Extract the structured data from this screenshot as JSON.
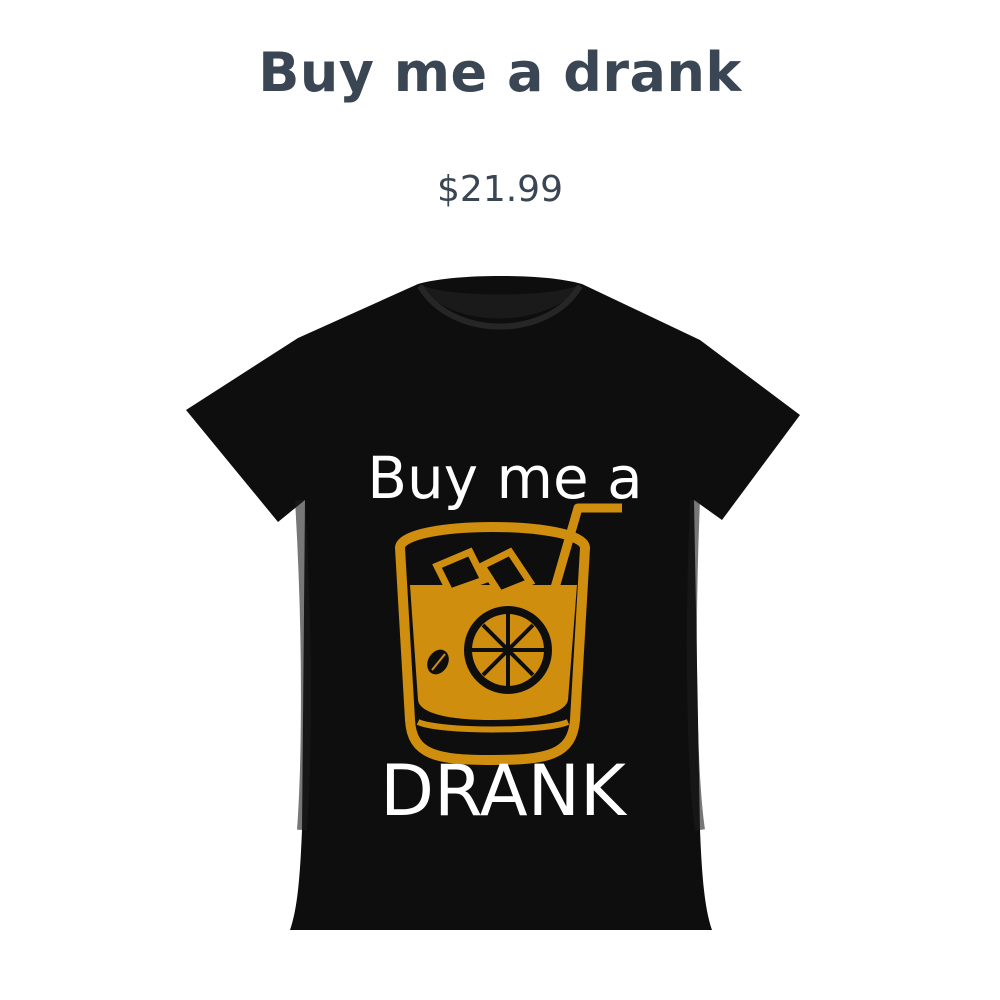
{
  "product": {
    "title": "Buy me a drank",
    "price": "$21.99",
    "image": {
      "subject": "tshirt-black",
      "print_line1": "Buy me a",
      "print_line2": "DRANK",
      "shirt_color": "#0e0e0e",
      "graphic_color": "#d08e0e",
      "print_text_color": "#ffffff"
    }
  }
}
